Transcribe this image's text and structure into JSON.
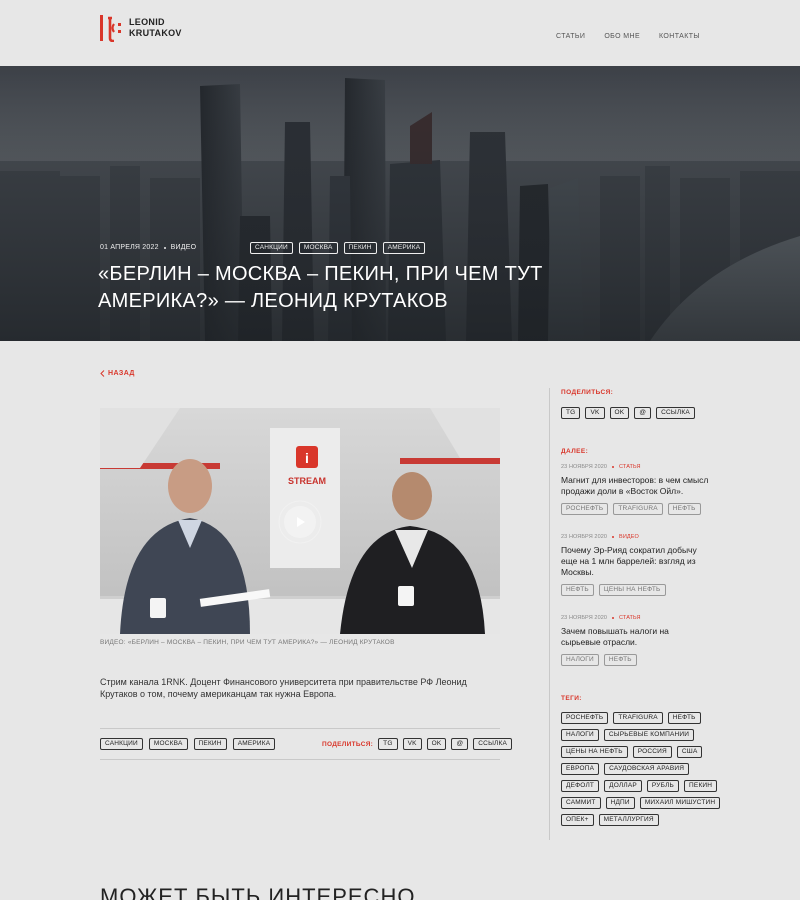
{
  "brand": {
    "line1": "LEONID",
    "line2": "KRUTAKOV",
    "accent": "#d9362a"
  },
  "nav": [
    "СТАТЬИ",
    "ОБО МНЕ",
    "КОНТАКТЫ"
  ],
  "hero": {
    "date": "01 АПРЕЛЯ 2022",
    "type": "ВИДЕО",
    "tags": [
      "САНКЦИИ",
      "МОСКВА",
      "ПЕКИН",
      "АМЕРИКА"
    ],
    "title": "«БЕРЛИН – МОСКВА – ПЕКИН, ПРИ ЧЕМ ТУТ АМЕРИКА?» — ЛЕОНИД КРУТАКОВ"
  },
  "back_label": "НАЗАД",
  "video": {
    "channel_logo": "STREAM",
    "caption": "ВИДЕО: «БЕРЛИН – МОСКВА – ПЕКИН, ПРИ ЧЕМ ТУТ АМЕРИКА?» — ЛЕОНИД КРУТАКОВ"
  },
  "description": "Стрим канала 1RNK. Доцент Финансового университета при правительстве РФ Леонид Крутаков о том, почему американцам так нужна Европа.",
  "bottom_tags": [
    "САНКЦИИ",
    "МОСКВА",
    "ПЕКИН",
    "АМЕРИКА"
  ],
  "share": {
    "label": "ПОДЕЛИТЬСЯ:",
    "buttons": [
      "TG",
      "VK",
      "OK",
      "@",
      "ССЫЛКА"
    ]
  },
  "sidebar": {
    "share_label": "ПОДЕЛИТЬСЯ:",
    "next_label": "ДАЛЕЕ:",
    "articles": [
      {
        "date": "23 НОЯБРЯ 2020",
        "type": "СТАТЬЯ",
        "title": "Магнит для инвесторов: в чем смысл продажи доли в «Восток Ойл».",
        "tags": [
          "РОСНЕФТЬ",
          "TRAFIGURA",
          "НЕФТЬ"
        ]
      },
      {
        "date": "23 НОЯБРЯ 2020",
        "type": "ВИДЕО",
        "title": "Почему Эр-Рияд сократил добычу еще на 1 млн баррелей: взгляд из Москвы.",
        "tags": [
          "НЕФТЬ",
          "ЦЕНЫ НА НЕФТЬ"
        ]
      },
      {
        "date": "23 НОЯБРЯ 2020",
        "type": "СТАТЬЯ",
        "title": "Зачем повышать налоги на сырьевые отрасли.",
        "tags": [
          "НАЛОГИ",
          "НЕФТЬ"
        ]
      }
    ],
    "tags_label": "ТЕГИ:",
    "tags": [
      "РОСНЕФТЬ",
      "TRAFIGURA",
      "НЕФТЬ",
      "НАЛОГИ",
      "СЫРЬЕВЫЕ КОМПАНИИ",
      "ЦЕНЫ НА НЕФТЬ",
      "РОССИЯ",
      "США",
      "ЕВРОПА",
      "САУДОВСКАЯ АРАВИЯ",
      "ДЕФОЛТ",
      "ДОЛЛАР",
      "РУБЛЬ",
      "ПЕКИН",
      "САММИТ",
      "НДПИ",
      "МИХАИЛ МИШУСТИН",
      "ОПЕК+",
      "МЕТАЛЛУРГИЯ"
    ]
  },
  "more_title": "МОЖЕТ БЫТЬ ИНТЕРЕСНО"
}
